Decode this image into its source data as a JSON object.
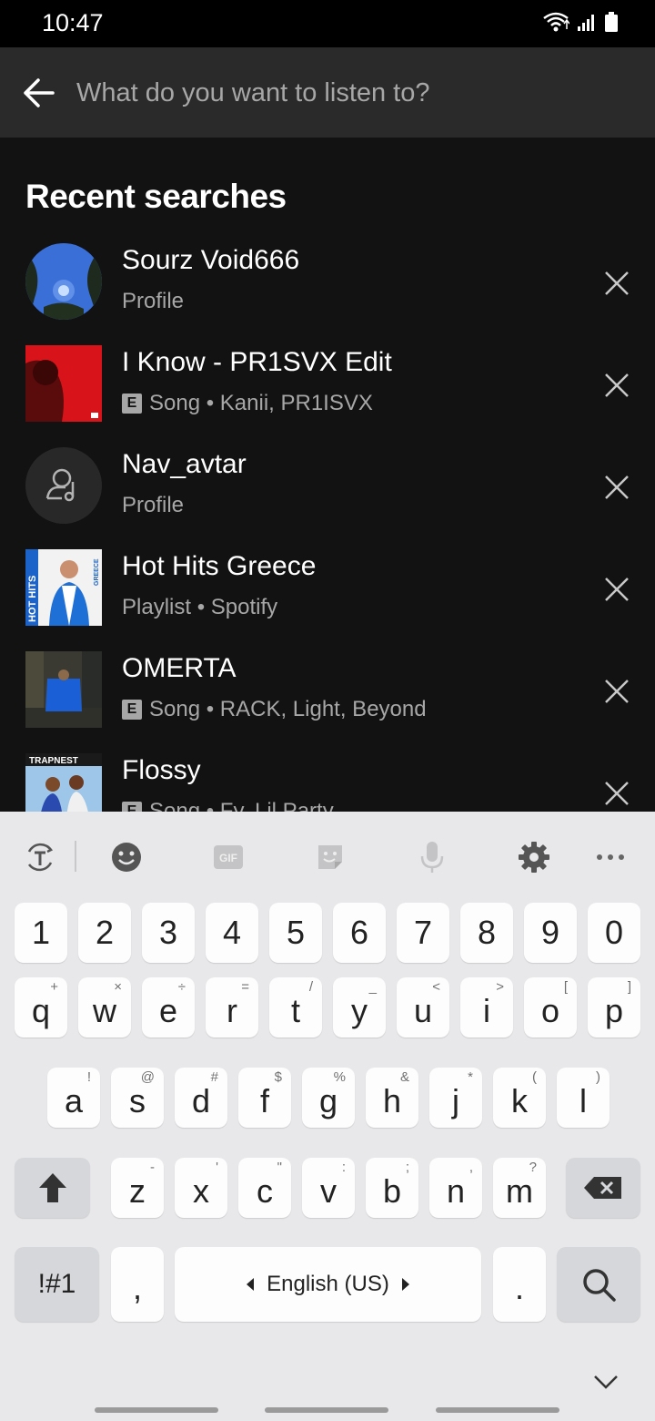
{
  "status_bar": {
    "time": "10:47"
  },
  "search": {
    "placeholder": "What do you want to listen to?"
  },
  "recent": {
    "title": "Recent searches",
    "items": [
      {
        "title": "Sourz Void666",
        "subtitle": "Profile",
        "explicit": false,
        "thumb": "profile-photo"
      },
      {
        "title": "I Know - PR1SVX Edit",
        "subtitle": "Song • Kanii, PR1ISVX",
        "explicit": true,
        "thumb": "album-art-red"
      },
      {
        "title": "Nav_avtar",
        "subtitle": "Profile",
        "explicit": false,
        "thumb": "default-profile-icon"
      },
      {
        "title": "Hot Hits Greece",
        "subtitle": "Playlist • Spotify",
        "explicit": false,
        "thumb": "playlist-cover-hot-hits-greece"
      },
      {
        "title": "OMERTA",
        "subtitle": "Song • RACK, Light, Beyond",
        "explicit": true,
        "thumb": "album-art-omerta"
      },
      {
        "title": "Flossy",
        "subtitle": "Song • Fy, Lil Party",
        "explicit": true,
        "thumb": "album-art-trapnest"
      }
    ],
    "explicit_badge": "E",
    "cover_texts": {
      "hot_hits": "HOT HITS",
      "greece": "GREECE",
      "trapnest": "TRAPNEST"
    }
  },
  "keyboard": {
    "toolbar": {
      "gif_label": "GIF"
    },
    "number_row": [
      "1",
      "2",
      "3",
      "4",
      "5",
      "6",
      "7",
      "8",
      "9",
      "0"
    ],
    "row1": [
      {
        "k": "q",
        "h": "+"
      },
      {
        "k": "w",
        "h": "×"
      },
      {
        "k": "e",
        "h": "÷"
      },
      {
        "k": "r",
        "h": "="
      },
      {
        "k": "t",
        "h": "/"
      },
      {
        "k": "y",
        "h": "_"
      },
      {
        "k": "u",
        "h": "<"
      },
      {
        "k": "i",
        "h": ">"
      },
      {
        "k": "o",
        "h": "["
      },
      {
        "k": "p",
        "h": "]"
      }
    ],
    "row2": [
      {
        "k": "a",
        "h": "!"
      },
      {
        "k": "s",
        "h": "@"
      },
      {
        "k": "d",
        "h": "#"
      },
      {
        "k": "f",
        "h": "$"
      },
      {
        "k": "g",
        "h": "%"
      },
      {
        "k": "h",
        "h": "&"
      },
      {
        "k": "j",
        "h": "*"
      },
      {
        "k": "k",
        "h": "("
      },
      {
        "k": "l",
        "h": ")"
      }
    ],
    "row3": [
      {
        "k": "z",
        "h": "-"
      },
      {
        "k": "x",
        "h": "'"
      },
      {
        "k": "c",
        "h": "\""
      },
      {
        "k": "v",
        "h": ":"
      },
      {
        "k": "b",
        "h": ";"
      },
      {
        "k": "n",
        "h": ","
      },
      {
        "k": "m",
        "h": "?"
      }
    ],
    "symbols_label": "!#1",
    "comma": ",",
    "space_label": "English (US)",
    "period": "."
  },
  "colors": {
    "accent": "#1db954",
    "background": "#121212",
    "header": "#2a2a2a",
    "subtext": "#a7a7a7",
    "keyboard_bg": "#e8e8ea"
  }
}
